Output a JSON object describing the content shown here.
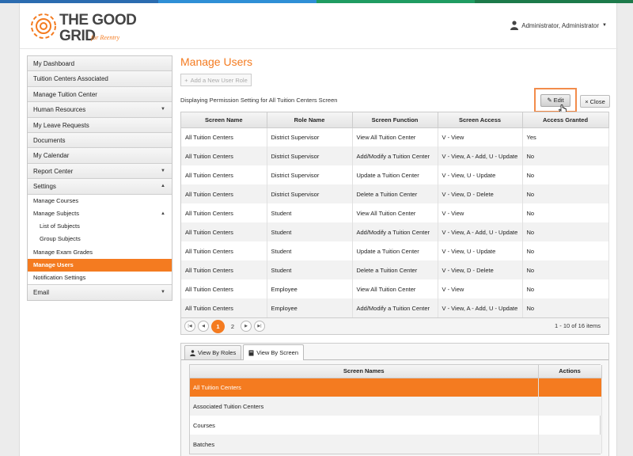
{
  "colors": {
    "accent": "#f47b20",
    "topbar": [
      "#2b6cb0",
      "#2f8fd6",
      "#1f9c62",
      "#1d7a4a"
    ]
  },
  "brand": {
    "logo_line1": "THE GOOD",
    "logo_line2": "GRID",
    "tagline": "for Reentry"
  },
  "user": {
    "name": "Administrator, Administrator",
    "icon": "user-icon"
  },
  "sidebar": {
    "items": [
      {
        "label": "My Dashboard"
      },
      {
        "label": "Tuition Centers Associated"
      },
      {
        "label": "Manage Tuition Center"
      },
      {
        "label": "Human Resources",
        "arrow": "▼"
      },
      {
        "label": "My Leave Requests"
      },
      {
        "label": "Documents"
      },
      {
        "label": "My Calendar"
      },
      {
        "label": "Report Center",
        "arrow": "▼"
      },
      {
        "label": "Settings",
        "arrow": "▲"
      }
    ],
    "sub_items": [
      {
        "label": "Manage Courses"
      },
      {
        "label": "Manage Subjects",
        "arrow": "▲"
      },
      {
        "label": "List of Subjects"
      },
      {
        "label": "Group Subjects"
      },
      {
        "label": "Manage Exam Grades"
      },
      {
        "label": "Manage Users"
      },
      {
        "label": "Notification Settings"
      }
    ],
    "email": {
      "label": "Email",
      "arrow": "▼"
    }
  },
  "main": {
    "title": "Manage Users",
    "add_button": "Add a New User Role",
    "permission_text": "Displaying Permission Setting for All Tuition Centers Screen",
    "edit_label": "Edit",
    "close_label": "Close"
  },
  "grid": {
    "columns": [
      "Screen Name",
      "Role Name",
      "Screen Function",
      "Screen Access",
      "Access Granted"
    ],
    "rows": [
      [
        "All Tuition Centers",
        "District Supervisor",
        "View All Tuition Center",
        "V - View",
        "Yes"
      ],
      [
        "All Tuition Centers",
        "District Supervisor",
        "Add/Modify a Tuition Center",
        "V - View, A - Add, U - Update",
        "No"
      ],
      [
        "All Tuition Centers",
        "District Supervisor",
        "Update a Tuition Center",
        "V - View, U - Update",
        "No"
      ],
      [
        "All Tuition Centers",
        "District Supervisor",
        "Delete a Tuition Center",
        "V - View, D - Delete",
        "No"
      ],
      [
        "All Tuition Centers",
        "Student",
        "View All Tuition Center",
        "V - View",
        "No"
      ],
      [
        "All Tuition Centers",
        "Student",
        "Add/Modify a Tuition Center",
        "V - View, A - Add, U - Update",
        "No"
      ],
      [
        "All Tuition Centers",
        "Student",
        "Update a Tuition Center",
        "V - View, U - Update",
        "No"
      ],
      [
        "All Tuition Centers",
        "Student",
        "Delete a Tuition Center",
        "V - View, D - Delete",
        "No"
      ],
      [
        "All Tuition Centers",
        "Employee",
        "View All Tuition Center",
        "V - View",
        "No"
      ],
      [
        "All Tuition Centers",
        "Employee",
        "Add/Modify a Tuition Center",
        "V - View, A - Add, U - Update",
        "No"
      ]
    ],
    "pager": {
      "pages": [
        "1",
        "2"
      ],
      "current": "1",
      "info": "1 - 10 of 16 items"
    }
  },
  "tabs": [
    {
      "label": "View By Roles",
      "icon": "user-icon"
    },
    {
      "label": "View By Screen",
      "icon": "document-icon"
    }
  ],
  "screens_table": {
    "columns": [
      "Screen Names",
      "Actions"
    ],
    "rows": [
      "All Tuition Centers",
      "Associated Tuition Centers",
      "Courses",
      "Batches"
    ]
  }
}
